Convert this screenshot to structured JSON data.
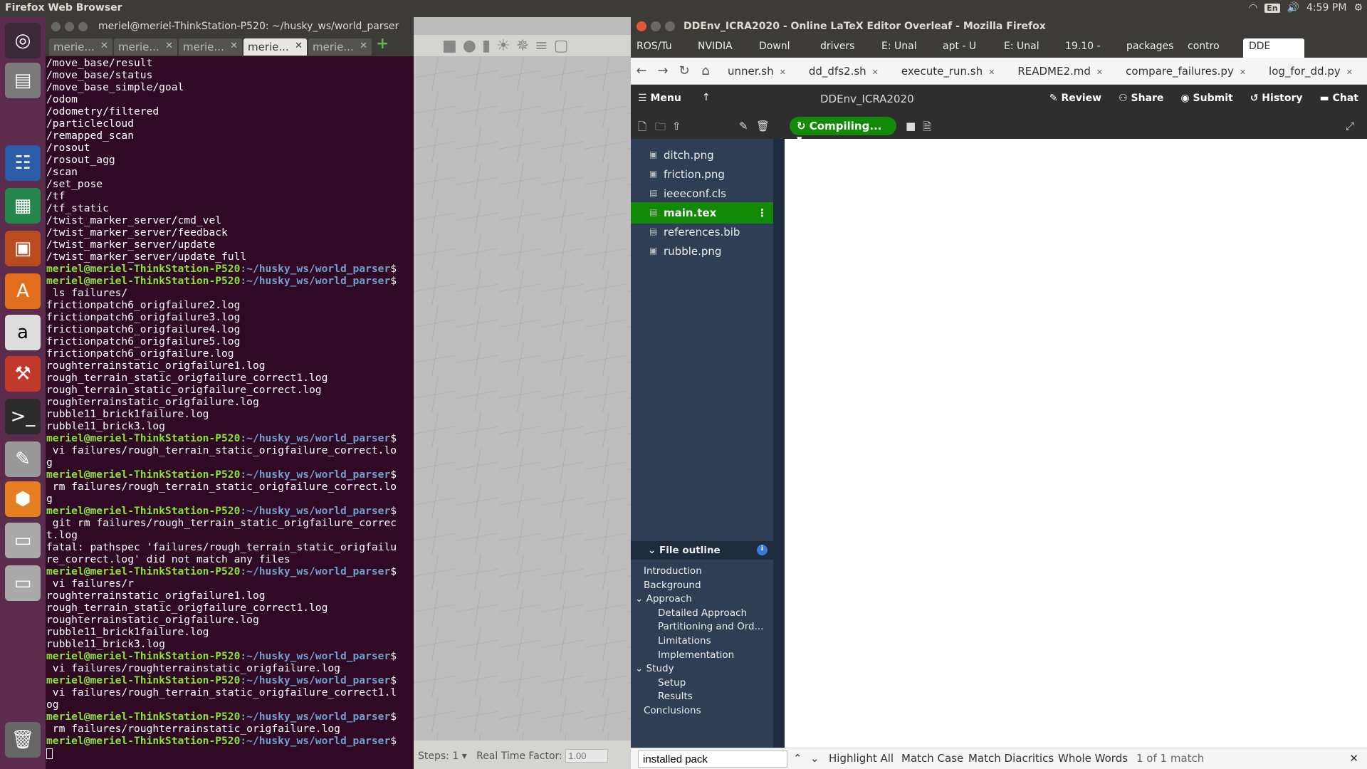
{
  "topbar": {
    "title": "Firefox Web Browser",
    "lang": "En",
    "time": "4:59 PM"
  },
  "launcher": {
    "items": [
      "ubuntu-icon",
      "files-icon",
      "writer-icon",
      "calc-icon",
      "impress-icon",
      "software-center-icon",
      "amazon-icon",
      "settings-icon",
      "terminal-icon",
      "text-editor-icon",
      "box-icon",
      "disk-icon",
      "drive-icon",
      "trash-icon"
    ]
  },
  "terminal": {
    "title": "meriel@meriel-ThinkStation-P520: ~/husky_ws/world_parser",
    "tabs": [
      "merie...",
      "merie...",
      "merie...",
      "merie...",
      "merie..."
    ],
    "prompt_user": "meriel@meriel-ThinkStation-P520",
    "prompt_path": ":~/husky_ws/world_parser",
    "lines": [
      [
        "o",
        "/move_base/result"
      ],
      [
        "o",
        "/move_base/status"
      ],
      [
        "o",
        "/move_base_simple/goal"
      ],
      [
        "o",
        "/odom"
      ],
      [
        "o",
        "/odometry/filtered"
      ],
      [
        "o",
        "/particlecloud"
      ],
      [
        "o",
        "/remapped_scan"
      ],
      [
        "o",
        "/rosout"
      ],
      [
        "o",
        "/rosout_agg"
      ],
      [
        "o",
        "/scan"
      ],
      [
        "o",
        "/set_pose"
      ],
      [
        "o",
        "/tf"
      ],
      [
        "o",
        "/tf_static"
      ],
      [
        "o",
        "/twist_marker_server/cmd_vel"
      ],
      [
        "o",
        "/twist_marker_server/feedback"
      ],
      [
        "o",
        "/twist_marker_server/update"
      ],
      [
        "o",
        "/twist_marker_server/update_full"
      ],
      [
        "p",
        ""
      ],
      [
        "p",
        ""
      ],
      [
        "o",
        " ls failures/"
      ],
      [
        "o",
        "frictionpatch6_origfailure2.log"
      ],
      [
        "o",
        "frictionpatch6_origfailure3.log"
      ],
      [
        "o",
        "frictionpatch6_origfailure4.log"
      ],
      [
        "o",
        "frictionpatch6_origfailure5.log"
      ],
      [
        "o",
        "frictionpatch6_origfailure.log"
      ],
      [
        "o",
        "roughterrainstatic_origfailure1.log"
      ],
      [
        "o",
        "rough_terrain_static_origfailure_correct1.log"
      ],
      [
        "o",
        "rough_terrain_static_origfailure_correct.log"
      ],
      [
        "o",
        "roughterrainstatic_origfailure.log"
      ],
      [
        "o",
        "rubble11_brick1failure.log"
      ],
      [
        "o",
        "rubble11_brick3.log"
      ],
      [
        "p",
        ""
      ],
      [
        "o",
        " vi failures/rough_terrain_static_origfailure_correct.lo"
      ],
      [
        "o",
        "g"
      ],
      [
        "p",
        ""
      ],
      [
        "o",
        " rm failures/rough_terrain_static_origfailure_correct.lo"
      ],
      [
        "o",
        "g"
      ],
      [
        "p",
        ""
      ],
      [
        "o",
        " git rm failures/rough_terrain_static_origfailure_correc"
      ],
      [
        "o",
        "t.log"
      ],
      [
        "o",
        "fatal: pathspec 'failures/rough_terrain_static_origfailu"
      ],
      [
        "o",
        "re_correct.log' did not match any files"
      ],
      [
        "p",
        ""
      ],
      [
        "o",
        " vi failures/r"
      ],
      [
        "o",
        "roughterrainstatic_origfailure1.log"
      ],
      [
        "o",
        "rough_terrain_static_origfailure_correct1.log"
      ],
      [
        "o",
        "roughterrainstatic_origfailure.log"
      ],
      [
        "o",
        "rubble11_brick1failure.log"
      ],
      [
        "o",
        "rubble11_brick3.log"
      ],
      [
        "p",
        ""
      ],
      [
        "o",
        " vi failures/roughterrainstatic_origfailure.log"
      ],
      [
        "p",
        ""
      ],
      [
        "o",
        " vi failures/rough_terrain_static_origfailure_correct1.l"
      ],
      [
        "o",
        "og"
      ],
      [
        "p",
        ""
      ],
      [
        "o",
        " rm failures/roughterrainstatic_origfailure.log"
      ],
      [
        "p",
        ""
      ]
    ]
  },
  "gazebo": {
    "steps_label": "Steps:",
    "steps_value": "1",
    "rtf_label": "Real Time Factor:",
    "rtf_value": "1.00"
  },
  "firefox": {
    "title": "DDEnv_ICRA2020 - Online LaTeX Editor Overleaf - Mozilla Firefox",
    "bookmarks": [
      "ROS/Tu",
      "NVIDIA",
      "Downl",
      "drivers",
      "E: Unal",
      "apt - U",
      "E: Unal",
      "19.10 -",
      "packages",
      "contro",
      "DDE"
    ],
    "open_tabs": [
      "unner.sh",
      "dd_dfs2.sh",
      "execute_run.sh",
      "README2.md",
      "compare_failures.py",
      "log_for_dd.py"
    ],
    "overleaf": {
      "menu": "Menu",
      "project": "DDEnv_ICRA2020",
      "review": "Review",
      "share": "Share",
      "submit": "Submit",
      "history": "History",
      "chat": "Chat",
      "compile": "Compiling...",
      "files": [
        "ditch.png",
        "friction.png",
        "ieeeconf.cls",
        "main.tex",
        "references.bib",
        "rubble.png"
      ],
      "outline_title": "File outline",
      "outline": [
        {
          "t": "Introduction",
          "l": 0
        },
        {
          "t": "Background",
          "l": 0
        },
        {
          "t": "Approach",
          "l": 0,
          "c": true
        },
        {
          "t": "Detailed Approach",
          "l": 1
        },
        {
          "t": "Partitioning and Ord...",
          "l": 1
        },
        {
          "t": "Limitations",
          "l": 1
        },
        {
          "t": "Implementation",
          "l": 1
        },
        {
          "t": "Study",
          "l": 0,
          "c": true
        },
        {
          "t": "Setup",
          "l": 1
        },
        {
          "t": "Results",
          "l": 1
        },
        {
          "t": "Conclusions",
          "l": 0
        }
      ]
    },
    "find": {
      "value": "installed pack",
      "highlight": "Highlight All",
      "match_case": "Match Case",
      "diacritics": "Match Diacritics",
      "whole": "Whole Words",
      "status": "1 of 1 match"
    }
  }
}
